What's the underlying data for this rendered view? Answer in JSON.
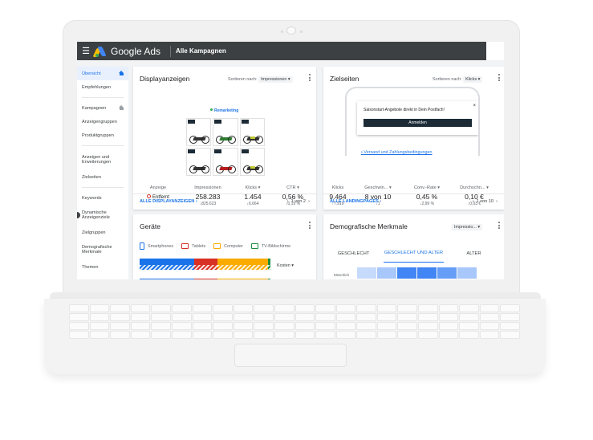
{
  "topbar": {
    "brand": "Google Ads",
    "campaign": "Alle Kampagnen"
  },
  "sidebar": {
    "items": [
      {
        "label": "Übersicht",
        "active": true,
        "icon": "home-icon"
      },
      {
        "label": "Empfehlungen"
      },
      {
        "label": "Kampagnen",
        "icon": "home-icon"
      },
      {
        "label": "Anzeigengruppen"
      },
      {
        "label": "Produktgruppen"
      },
      {
        "label": "Anzeigen und Erweiterungen"
      },
      {
        "label": "Zielseiten"
      },
      {
        "label": "Keywords"
      },
      {
        "label": "Dynamische Anzeigenziele"
      },
      {
        "label": "Zielgruppen"
      },
      {
        "label": "Demografische Merkmale"
      },
      {
        "label": "Themen"
      }
    ]
  },
  "display": {
    "title": "Displayanzeigen",
    "sort_label": "Sortieren nach:",
    "sort_value": "Impressionen",
    "remarketing": "Remarketing",
    "metrics": {
      "anzeige_label": "Anzeige",
      "anzeige_value": "Entfernt",
      "impressions_label": "Impressionen",
      "impressions_value": "258.283",
      "impressions_sub": "825.623",
      "klicks_label": "Klicks",
      "klicks_value": "1.454",
      "klicks_sub": "6.664",
      "ctr_label": "CTR",
      "ctr_value": "0,56 %",
      "ctr_sub": "0,19 %"
    },
    "footer_link": "ALLE DISPLAYANZEIGEN",
    "pager": "1 von 2"
  },
  "landing": {
    "title": "Zielseiten",
    "sort_label": "Sortieren nach:",
    "sort_value": "Klicks",
    "modal_text": "Saisonstart-Angebote direkt in Dein Postfach!",
    "modal_button": "Anmelden",
    "link": "Versand und Zahlungsbedingungen",
    "metrics": {
      "klicks_label": "Klicks",
      "klicks_value": "9.464",
      "klicks_sub": "7.919",
      "geschw_label": "Geschwin...",
      "geschw_value": "8 von 10",
      "geschw_sub": "1",
      "conv_label": "Conv.-Rate",
      "conv_value": "0,45 %",
      "conv_sub": "2,99 %",
      "cpc_label": "Durchschn...",
      "cpc_value": "0,10 €",
      "cpc_sub": "0,03 €"
    },
    "footer_link": "ALLE LANDINGPAGES",
    "pager": "1 von 10"
  },
  "devices": {
    "title": "Geräte",
    "legend": [
      {
        "label": "Smartphones",
        "color": "#1a73e8"
      },
      {
        "label": "Tablets",
        "color": "#d93025"
      },
      {
        "label": "Computer",
        "color": "#f9ab00"
      },
      {
        "label": "TV-Bildschirme",
        "color": "#1e8e3e"
      }
    ],
    "metric_select": "Kosten"
  },
  "demo": {
    "title": "Demografische Merkmale",
    "sort_value": "Impressio...",
    "tabs": [
      "GESCHLECHT",
      "GESCHLECHT UND ALTER",
      "ALTER"
    ],
    "row_label": "Männlich"
  },
  "colors": {
    "accent": "#1a73e8",
    "topbar": "#3c4043",
    "heat": [
      "#c6dafc",
      "#a8c7fa",
      "#4285f4",
      "#4285f4",
      "#669df6",
      "#a8c7fa"
    ]
  }
}
